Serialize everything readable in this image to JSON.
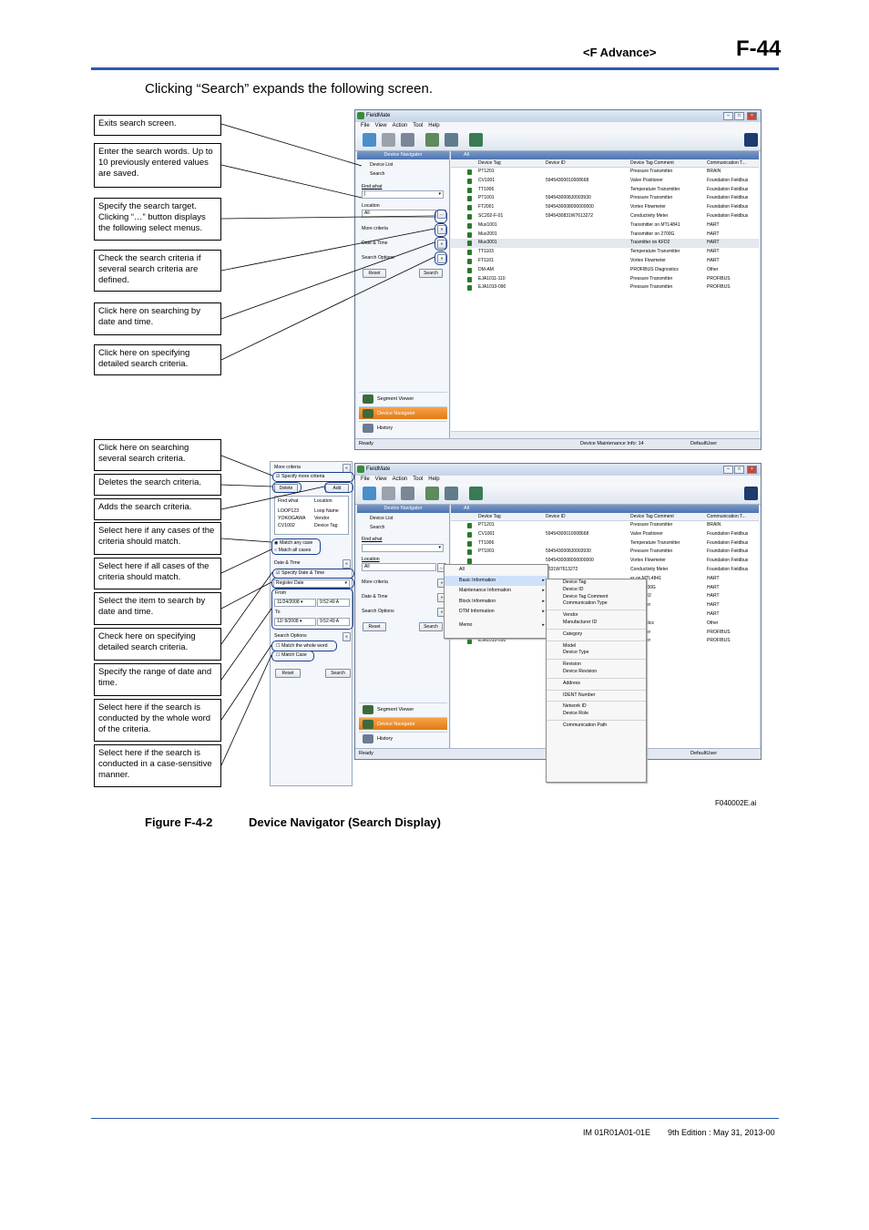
{
  "header": {
    "section": "<F Advance>",
    "page_number": "F-44"
  },
  "intro": "Clicking “Search” expands the following screen.",
  "callouts": [
    "Exits search screen.",
    "Enter the search words. Up to 10 previously entered values are saved.",
    "Specify the search target. Clicking “…” button displays the following select menus.",
    "Check the search criteria if several search criteria are defined.",
    "Click here on searching by date and time.",
    "Click here on specifying detailed search criteria.",
    "Click here on searching several search criteria.",
    "Deletes the search criteria.",
    "Adds the search criteria.",
    "Select here if any cases of the criteria should match.",
    "Select here if all cases of the criteria should match.",
    "Select the item to search by date and time.",
    "Check here on specifying detailed search criteria.",
    "Specify the range of date and time.",
    "Select here if the search is conducted by the whole word of the criteria.",
    "Select here if the search is conducted in a case-sensitive manner."
  ],
  "app": {
    "title": "FieldMate",
    "menus": [
      "File",
      "View",
      "Action",
      "Tool",
      "Help"
    ],
    "nav_header": "Device Navigator",
    "grid_header": "All",
    "device_list": "Device List",
    "search": "Search",
    "find_what": "Find what",
    "location": "Location",
    "location_value": "All",
    "more_criteria": "More criteria",
    "date_time": "Date & Time",
    "search_options": "Search Options",
    "reset": "Reset",
    "search_btn": "Search",
    "nav_buttons": [
      "Segment Viewer",
      "Device Navigator",
      "History"
    ],
    "columns": [
      "Device Tag",
      "Device ID",
      "Device Tag Comment",
      "Communication T..."
    ],
    "rows": [
      [
        "PT1201",
        "",
        "Pressure Transmitter",
        "BRAIN"
      ],
      [
        "CV1001",
        "59454300010008668",
        "Valve Positioner",
        "Foundation Fieldbus"
      ],
      [
        "TT1006",
        "",
        "Temperature Transmitter",
        "Foundation Fieldbus"
      ],
      [
        "PT1001",
        "5945430008J0003930",
        "Pressure Transmitter",
        "Foundation Fieldbus"
      ],
      [
        "FT2001",
        "5945430008000000000",
        "Vortex Flowmeter",
        "Foundation Fieldbus"
      ],
      [
        "SC202-F-01",
        "5945430831W7613272",
        "Conductivity Meter",
        "Foundation Fieldbus"
      ],
      [
        "Mux1001",
        "",
        "Transmitter on MTL4841",
        "HART"
      ],
      [
        "Mux2001",
        "",
        "Transmitter on 2700G",
        "HART"
      ],
      [
        "Mux3001",
        "",
        "Trasmitter on KFD2",
        "HART"
      ],
      [
        "TT1103",
        "",
        "Temperature Transmitter",
        "HART"
      ],
      [
        "FT1101",
        "",
        "Vortex Flowmeter",
        "HART"
      ],
      [
        "DM-AM",
        "",
        "PROFIBUS Diagnostics",
        "Other"
      ],
      [
        "EJA1011-110",
        "",
        "Pressure Transmitter",
        "PROFIBUS"
      ],
      [
        "EJA1010-090",
        "",
        "Pressure Transmitter",
        "PROFIBUS"
      ]
    ],
    "rows2": [
      [
        "PT1201",
        "",
        "Pressure Transmitter",
        "BRAIN"
      ],
      [
        "CV1001",
        "59454300010008668",
        "Valve Positioner",
        "Foundation Fieldbus"
      ],
      [
        "TT1006",
        "",
        "Temperature Transmitter",
        "Foundation Fieldbus"
      ],
      [
        "PT1001",
        "5945430008J0003930",
        "Pressure Transmitter",
        "Foundation Fieldbus"
      ],
      [
        "",
        "5945430008000000000",
        "Vortex Flowmeter",
        "Foundation Fieldbus"
      ],
      [
        "",
        "0831W7613272",
        "Conductivity Meter",
        "Foundation Fieldbus"
      ],
      [
        "",
        "",
        "er on MTL4841",
        "HART"
      ],
      [
        "",
        "",
        "er on 2700G",
        "HART"
      ],
      [
        "",
        "",
        "r on KFD2",
        "HART"
      ],
      [
        "",
        "",
        "ransmitter",
        "HART"
      ],
      [
        "",
        "",
        "meter",
        "HART"
      ],
      [
        "",
        "",
        "Diagnostics",
        "Other"
      ],
      [
        "EJA1011-110",
        "",
        "ransmitter",
        "PROFIBUS"
      ],
      [
        "EJA1010-090",
        "",
        "ransmitter",
        "PROFIBUS"
      ]
    ],
    "status_ready": "Ready",
    "status_info": "Device Maintenance Info: 14",
    "status_user": "DefaultUser",
    "menu1": [
      "All",
      "Basic Information",
      "Maintenance Information",
      "Block Information",
      "DTM Information",
      "Memo"
    ],
    "submenu": [
      "Device Tag",
      "Device ID",
      "Device Tag Comment",
      "Communication Type",
      "Vendor",
      "Manufacturer ID",
      "Category",
      "Model",
      "Device Type",
      "Revision",
      "Device Revision",
      "Address",
      "IDENT Number",
      "Network ID",
      "Device Role",
      "Communication Path"
    ]
  },
  "side": {
    "more_criteria": "More criteria",
    "specify_more": "Specify more criteria",
    "delete": "Delete",
    "add": "Add",
    "find_what": "Find what",
    "location": "Location",
    "criteria": [
      [
        "LOOP123",
        "Loop Name"
      ],
      [
        "YOKOGAWA",
        "Vendor"
      ],
      [
        "CV1002",
        "Device Tag"
      ]
    ],
    "match_any": "Match any case",
    "match_all": "Match all cases",
    "date_time": "Date & Time",
    "specify_date": "Specify Date & Time",
    "register_date": "Register Date",
    "from": "From",
    "from_date": "11/24/2008",
    "from_time": "9:52:49 A",
    "to": "To",
    "to_date": "12/ 8/2008",
    "to_time": "9:52:49 A",
    "search_options": "Search Options",
    "whole_word": "Match the whole word",
    "match_case": "Match Case",
    "reset": "Reset",
    "search": "Search"
  },
  "figure": {
    "id": "F040002E.ai",
    "number": "Figure F-4-2",
    "title": "Device Navigator (Search Display)"
  },
  "footer": {
    "doc": "IM 01R01A01-01E",
    "edition": "9th Edition : May 31, 2013-00"
  }
}
